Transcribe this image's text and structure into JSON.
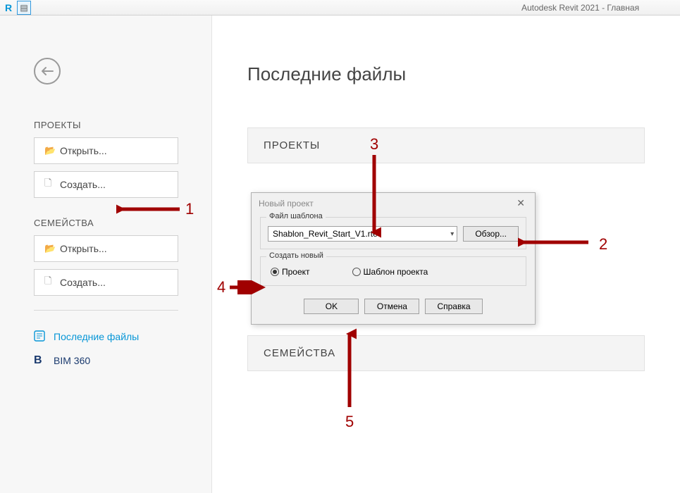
{
  "app": {
    "title": "Autodesk Revit 2021 - Главная"
  },
  "sidebar": {
    "back_icon_name": "back-arrow",
    "sections": {
      "projects_label": "ПРОЕКТЫ",
      "families_label": "СЕМЕЙСТВА"
    },
    "buttons": {
      "open": "Открыть...",
      "create": "Создать..."
    },
    "nav": {
      "recent": "Последние файлы",
      "bim360": "BIM 360"
    }
  },
  "main": {
    "page_title": "Последние файлы",
    "panels": {
      "projects": "ПРОЕКТЫ",
      "families": "СЕМЕЙСТВА"
    }
  },
  "dialog": {
    "title": "Новый проект",
    "group_template_label": "Файл шаблона",
    "template_selected": "Shablon_Revit_Start_V1.rte",
    "browse": "Обзор...",
    "group_create_label": "Создать новый",
    "radio_project": "Проект",
    "radio_template": "Шаблон проекта",
    "ok": "OK",
    "cancel": "Отмена",
    "help": "Справка"
  },
  "annotations": {
    "n1": "1",
    "n2": "2",
    "n3": "3",
    "n4": "4",
    "n5": "5"
  }
}
